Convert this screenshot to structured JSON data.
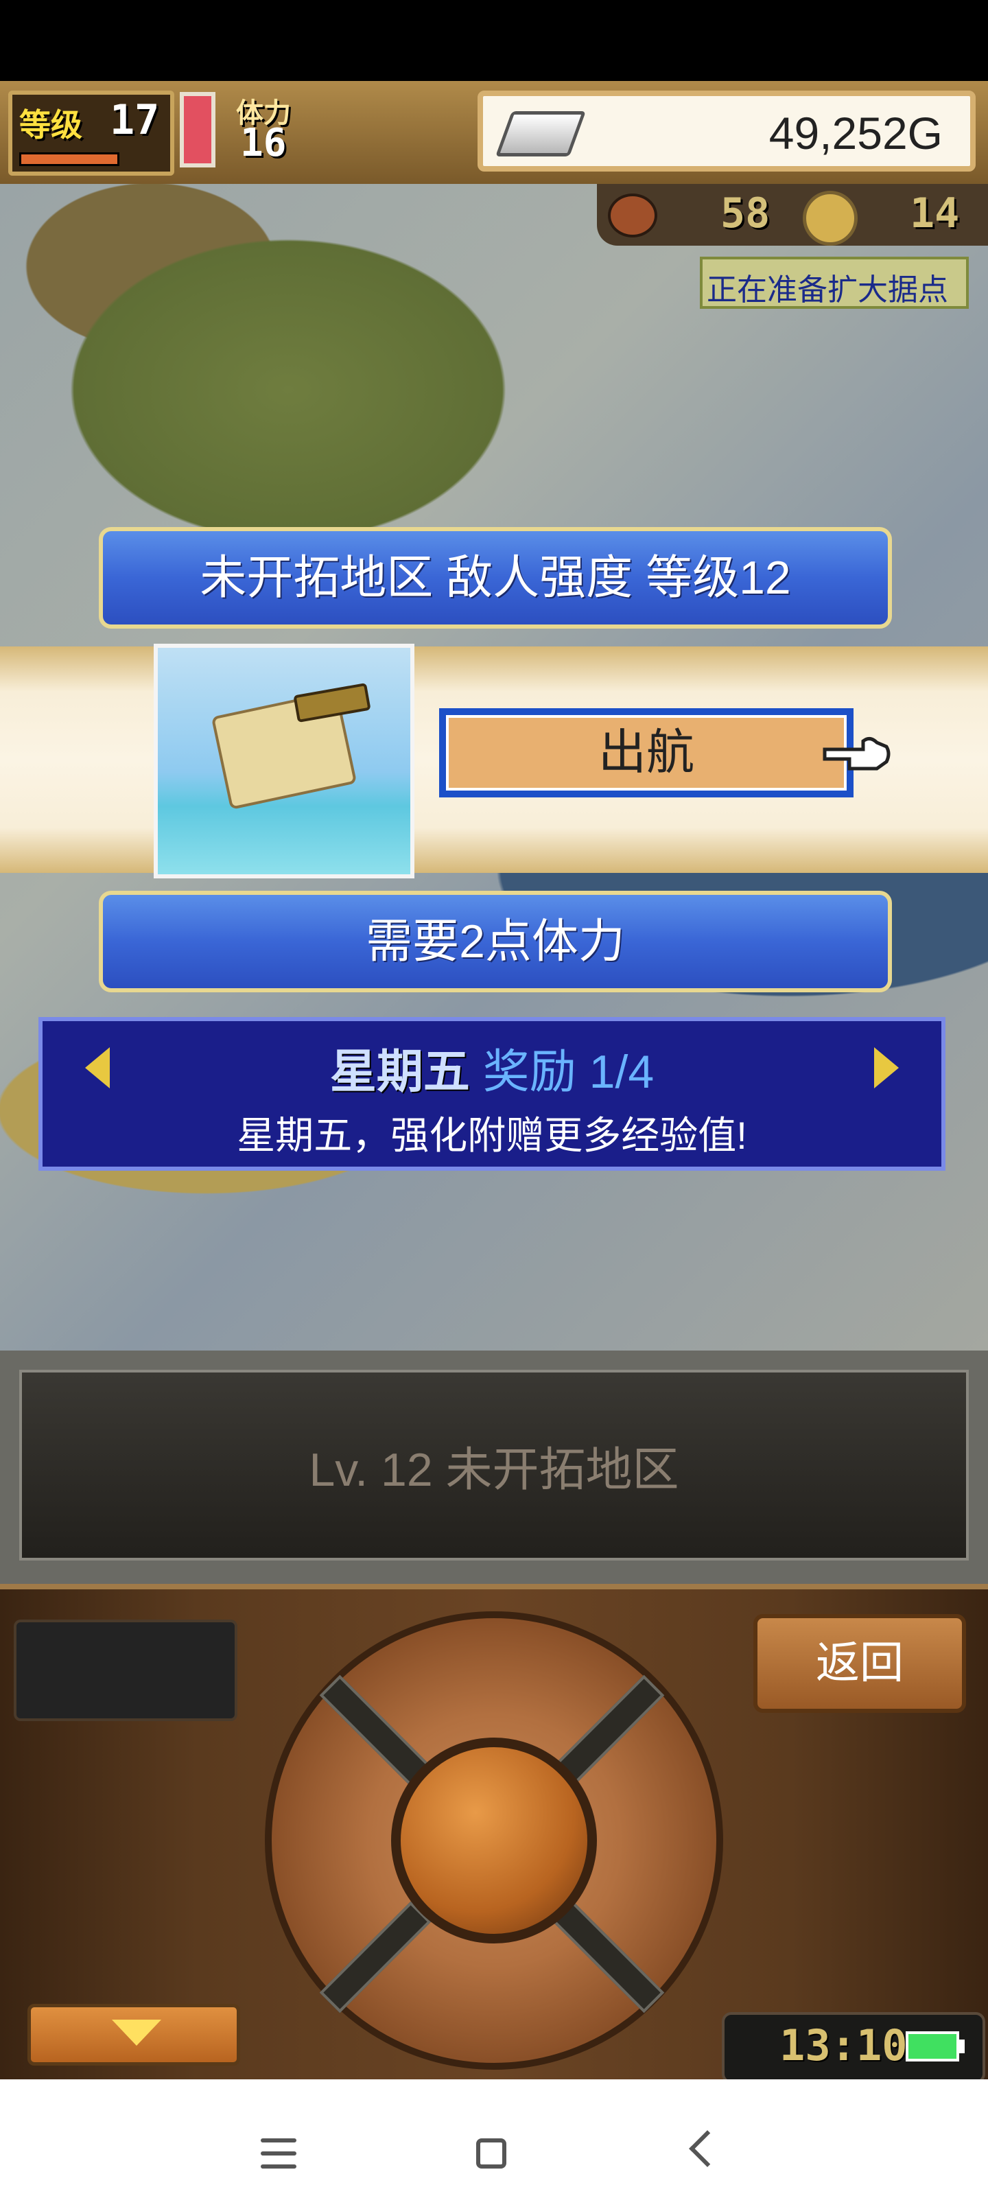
{
  "hud": {
    "level_label": "等级",
    "level_value": "17",
    "stamina_label": "体力",
    "stamina_value": "16",
    "gold": "49,252G"
  },
  "resources": {
    "food_value": "58",
    "coin_value": "14"
  },
  "map": {
    "status_badge": "正在准备扩大据点"
  },
  "area_banner": "未开拓地区  敌人强度 等级12",
  "sail_button": "出航",
  "stamina_cost": "需要2点体力",
  "bonus": {
    "day": "星期五",
    "reward": "奖励 1/4",
    "description": "星期五，强化附赠更多经验值!"
  },
  "info_panel": {
    "text": "Lv. 12 未开拓地区"
  },
  "controls": {
    "back_label": "返回",
    "clock": "13:10"
  },
  "colors": {
    "banner_blue": "#3a66d6",
    "bonus_panel": "#1a1e8a",
    "sail_button": "#e8b070",
    "wood": "#5a3a1e"
  },
  "icons": {
    "gold": "silver-bar-icon",
    "food": "meat-icon",
    "coin": "coin-icon",
    "pointer": "pointing-hand-icon",
    "prev": "arrow-left-icon",
    "next": "arrow-right-icon",
    "down": "arrow-down-icon",
    "battery": "battery-icon"
  }
}
